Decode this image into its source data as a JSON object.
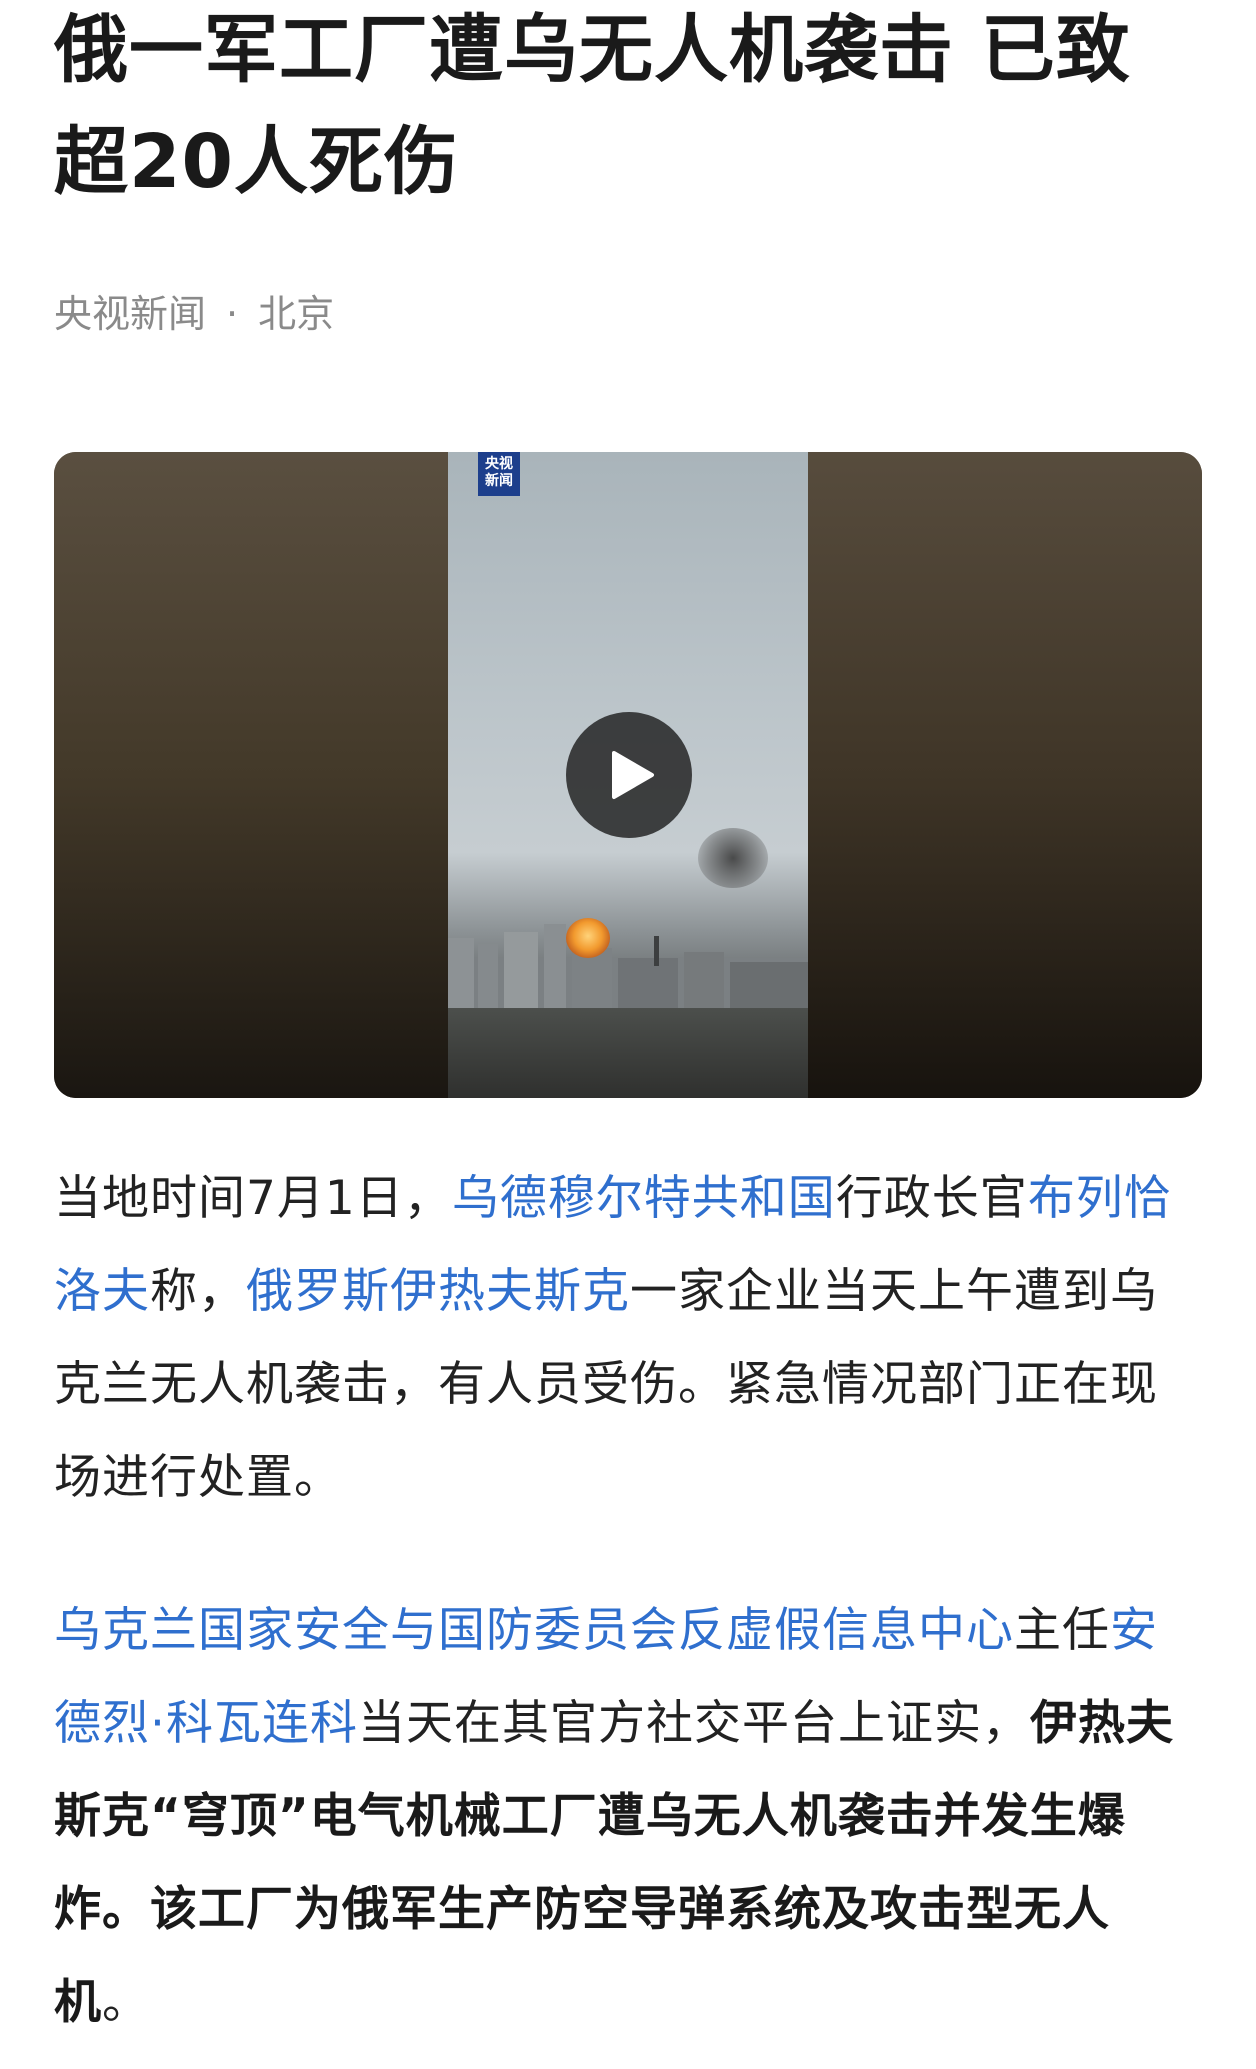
{
  "article": {
    "title": "俄一军工厂遭乌无人机袭击 已致超20人死伤",
    "source": "央视新闻",
    "separator": "·",
    "location": "北京"
  },
  "video": {
    "logo_line1": "央视",
    "logo_line2": "新闻",
    "play_icon": "play-icon"
  },
  "paragraph1": {
    "t1": "当地时间7月1日，",
    "link1": "乌德穆尔特共和国",
    "t2": "行政长官",
    "link2": "布列恰洛夫",
    "t3": "称，",
    "link3": "俄罗斯伊热夫斯克",
    "t4": "一家企业当天上午遭到乌克兰无人机袭击，有人员受伤。紧急情况部门正在现场进行处置。"
  },
  "paragraph2": {
    "link1": "乌克兰国家安全与国防委员会反虚假信息中心",
    "t1": "主任",
    "link2": "安德烈·科瓦连科",
    "t2": "当天在其官方社交平台上证实，",
    "bold1": "伊热夫斯克“穹顶”电气机械工厂遭乌无人机袭击并发生爆炸。该工厂为",
    "link3": "俄军",
    "bold2": "生产防空导弹系统及攻击型无人机",
    "t3": "。"
  },
  "colors": {
    "link": "#2f6fce",
    "text": "#222222",
    "meta": "#8a8a8a",
    "logo_bg": "#1d3f8c"
  }
}
